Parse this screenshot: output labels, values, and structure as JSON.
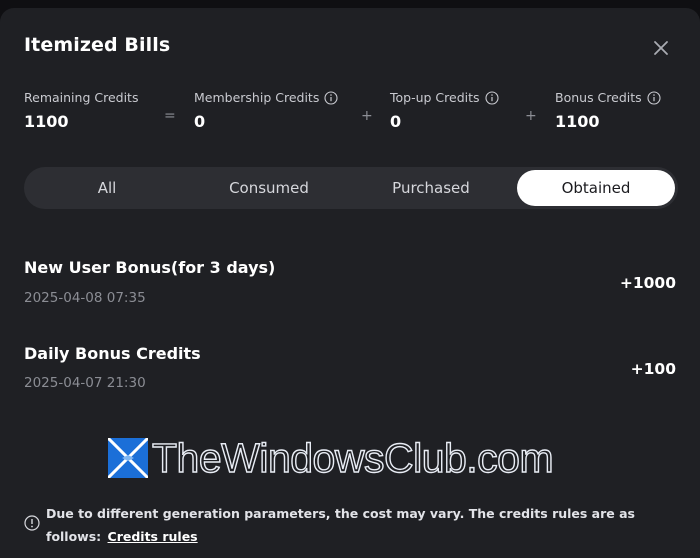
{
  "dialog": {
    "title": "Itemized Bills"
  },
  "summary": {
    "remaining": {
      "label": "Remaining Credits",
      "value": "1100"
    },
    "equals": "=",
    "membership": {
      "label": "Membership Credits",
      "value": "0"
    },
    "plus1": "+",
    "topup": {
      "label": "Top-up Credits",
      "value": "0"
    },
    "plus2": "+",
    "bonus": {
      "label": "Bonus Credits",
      "value": "1100"
    }
  },
  "tabs": [
    {
      "label": "All"
    },
    {
      "label": "Consumed"
    },
    {
      "label": "Purchased"
    },
    {
      "label": "Obtained"
    }
  ],
  "active_tab": "Obtained",
  "items": [
    {
      "title": "New User Bonus(for 3 days)",
      "date": "2025-04-08 07:35",
      "amount": "+1000"
    },
    {
      "title": "Daily Bonus Credits",
      "date": "2025-04-07 21:30",
      "amount": "+100"
    }
  ],
  "watermark": {
    "text": "TheWindowsClub.com"
  },
  "footer": {
    "text": "Due to different generation parameters, the cost may vary. The credits rules are as follows:",
    "link": "Credits rules"
  },
  "icons": {
    "close": "close-icon",
    "info": "info-icon",
    "logo": "windows-logo-icon"
  },
  "colors": {
    "background": "#1f2024",
    "tab_bar": "#2d2e33",
    "active_tab": "#ffffff",
    "muted_text": "#8b8d94"
  }
}
